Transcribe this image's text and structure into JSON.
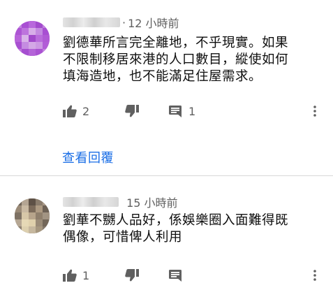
{
  "comments": [
    {
      "time": "12 小時前",
      "lines": [
        "劉德華所言完全離地，不乎現實。如果",
        "不限制移居來港的人口數目，縱使如何",
        "填海造地，也不能滿足住屋需求。"
      ],
      "like_count": "2",
      "reply_count": "1",
      "view_replies_label": "查看回覆"
    },
    {
      "time": "15 小時前",
      "lines": [
        "劉華不嬲人品好，係娛樂圈入面難得既",
        "偶像，可惜俾人利用"
      ],
      "like_count": "1"
    }
  ],
  "icons": {
    "like": "thumb-up-icon",
    "dislike": "thumb-down-icon",
    "reply": "comment-icon",
    "more": "more-vert-icon"
  },
  "colors": {
    "text": "#0f0f0f",
    "secondary": "#606060",
    "link": "#1a6ee6",
    "divider": "#d8d8d8"
  }
}
